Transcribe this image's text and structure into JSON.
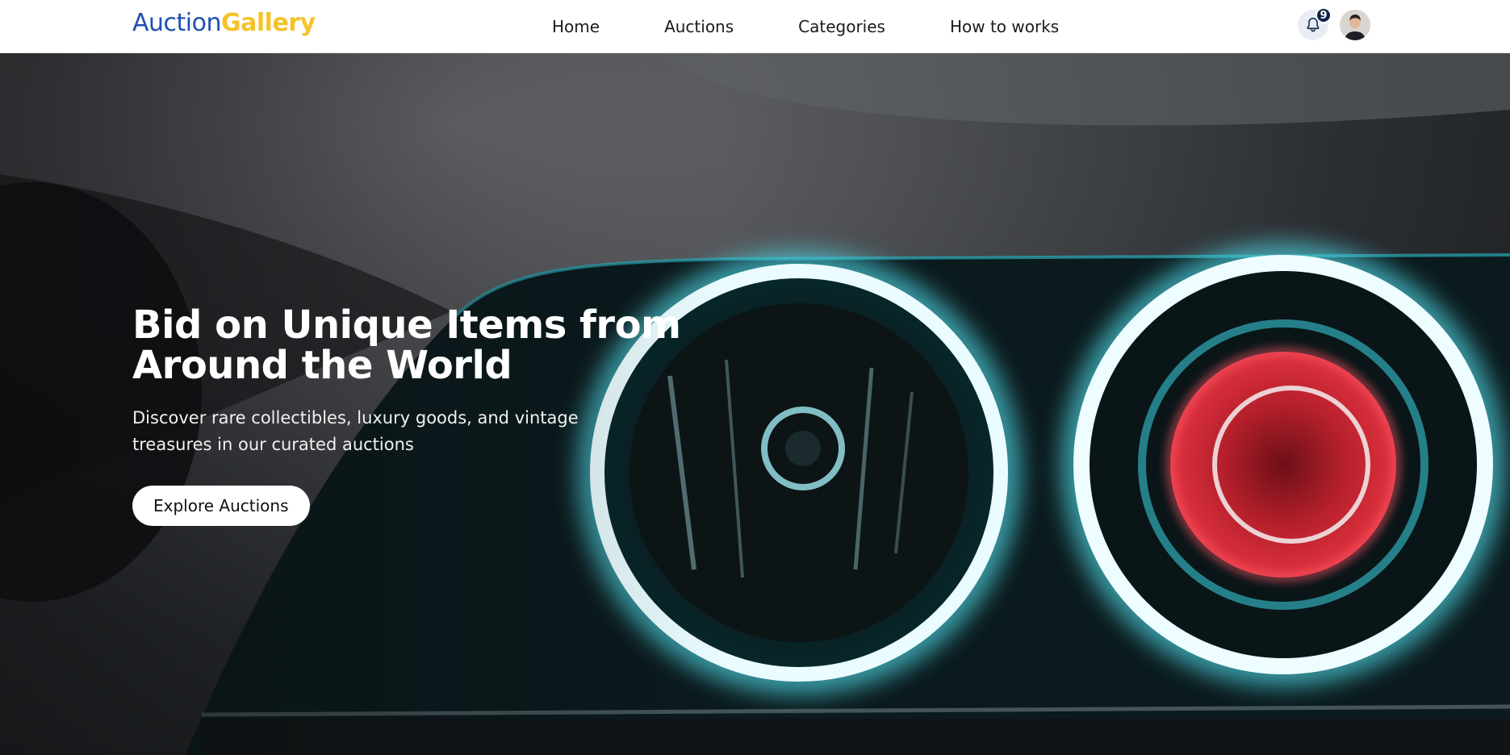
{
  "brand": {
    "part1": "Auction",
    "part2": "Gallery"
  },
  "nav": {
    "links": [
      "Home",
      "Auctions",
      "Categories",
      "How to works"
    ]
  },
  "notifications": {
    "count": "9",
    "icon": "bell-icon"
  },
  "user": {
    "avatar_icon": "user-avatar"
  },
  "hero": {
    "title_line1": "Bid on Unique Items from",
    "title_line2": "Around the World",
    "subtitle_line1": "Discover rare collectibles, luxury goods, and vintage",
    "subtitle_line2": "treasures in our curated auctions",
    "cta_label": "Explore Auctions"
  },
  "colors": {
    "brand_blue": "#1f4fb3",
    "brand_yellow": "#f5c329",
    "badge_navy": "#0f2348",
    "headlight_glow": "#4fd6e3",
    "inner_red": "#e0323f"
  }
}
